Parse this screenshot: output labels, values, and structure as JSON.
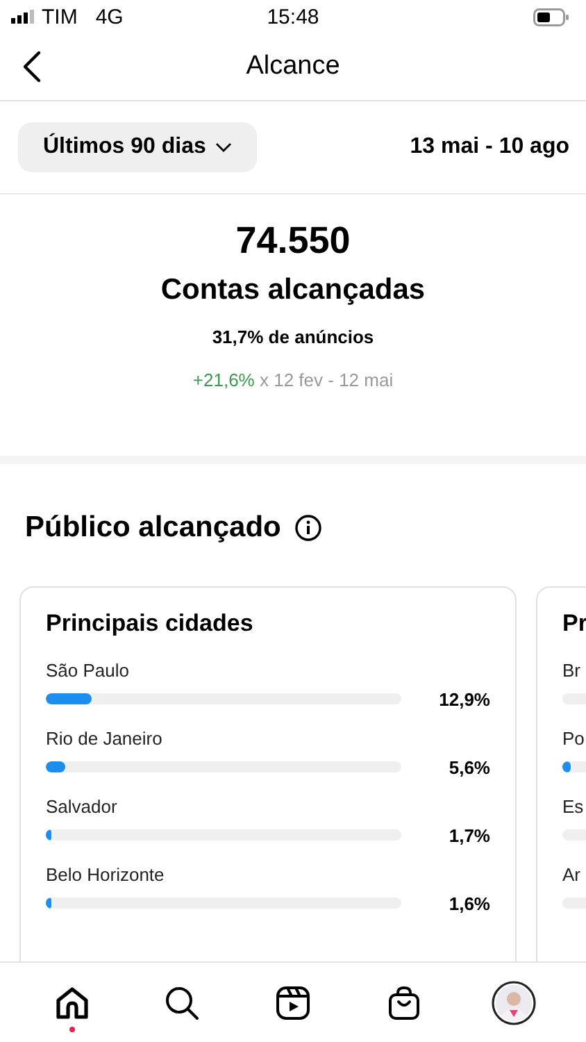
{
  "status_bar": {
    "carrier": "TIM",
    "network": "4G",
    "time": "15:48"
  },
  "header": {
    "title": "Alcance"
  },
  "period": {
    "label": "Últimos 90 dias",
    "range": "13 mai - 10 ago"
  },
  "summary": {
    "value": "74.550",
    "label": "Contas alcançadas",
    "ads_share": "31,7% de anúncios",
    "change": "+21,6%",
    "comparison": "x 12 fev - 12 mai"
  },
  "section": {
    "title": "Público alcançado"
  },
  "cards": [
    {
      "title": "Principais cidades",
      "rows": [
        {
          "name": "São Paulo",
          "level": 0.13,
          "value": "12,9%"
        },
        {
          "name": "Rio de Janeiro",
          "level": 0.056,
          "value": "5,6%"
        },
        {
          "name": "Salvador",
          "level": 0.017,
          "value": "1,7%"
        },
        {
          "name": "Belo Horizonte",
          "level": 0.016,
          "value": "1,6%"
        }
      ]
    },
    {
      "title": "Pr",
      "rows": [
        {
          "name": "Br"
        },
        {
          "name": "Po",
          "level": 0.02
        },
        {
          "name": "Es"
        },
        {
          "name": "Ar"
        }
      ]
    }
  ],
  "nav": [
    {
      "kind": "home",
      "selected": true
    },
    {
      "kind": "search",
      "selected": false
    },
    {
      "kind": "reels",
      "selected": false
    },
    {
      "kind": "shop",
      "selected": false
    },
    {
      "kind": "profile",
      "selected": false
    }
  ]
}
